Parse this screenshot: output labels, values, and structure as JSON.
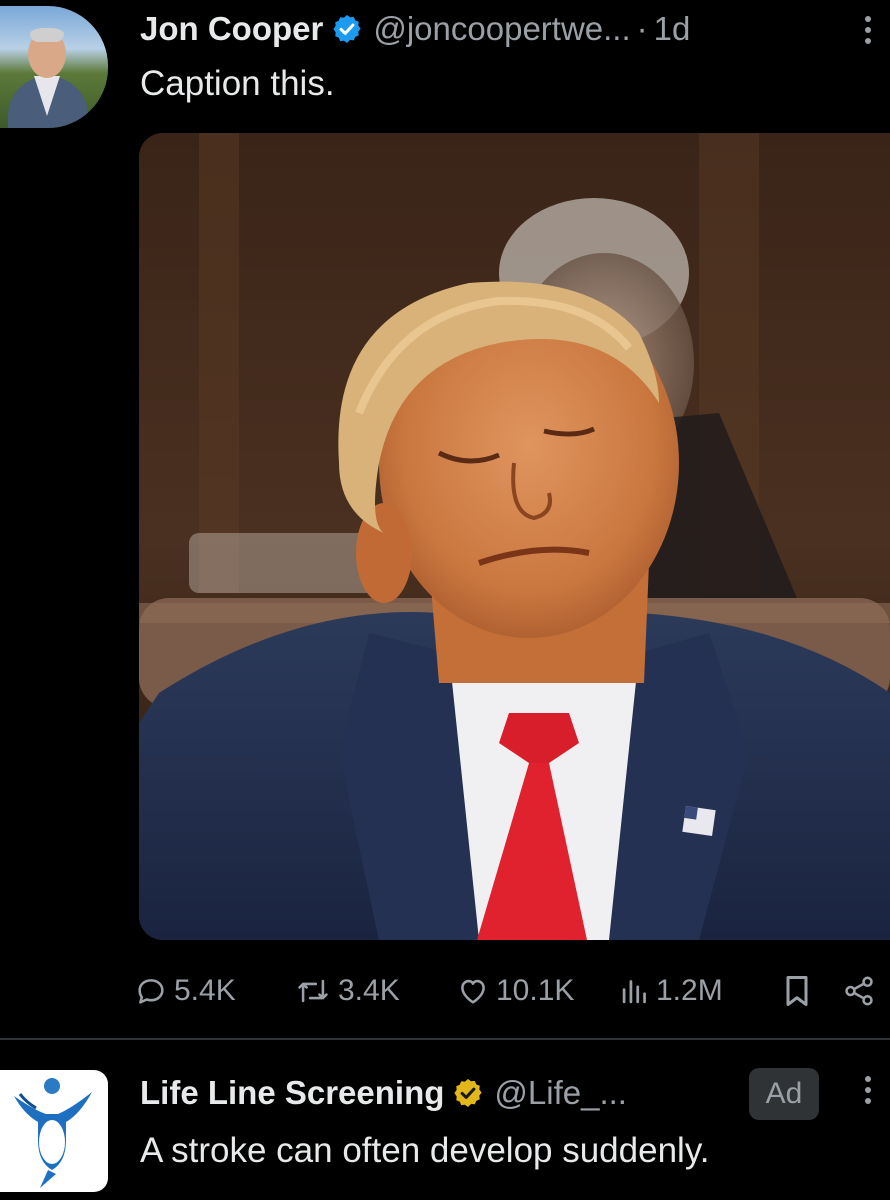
{
  "colors": {
    "background": "#000000",
    "text_primary": "#e7e9ea",
    "text_secondary": "#9aa0a6",
    "verified_blue": "#1d9bf0",
    "verified_gold": "#e2b719",
    "divider": "#2f3336"
  },
  "tweet": {
    "author_name": "Jon Cooper",
    "handle": "@joncoopertwe...",
    "separator": "·",
    "time": "1d",
    "text": "Caption this.",
    "verified_icon": "verified-blue-badge-icon",
    "media_icon": "photo",
    "actions": {
      "replies": "5.4K",
      "reposts": "3.4K",
      "likes": "10.1K",
      "views": "1.2M"
    },
    "action_icons": [
      "reply-icon",
      "repost-icon",
      "like-icon",
      "views-icon",
      "bookmark-icon",
      "share-icon"
    ]
  },
  "ad": {
    "author_name": "Life Line Screening",
    "handle": "@Life_...",
    "badge": "Ad",
    "text": "A stroke can often develop suddenly.",
    "verified_icon": "verified-gold-badge-icon"
  }
}
